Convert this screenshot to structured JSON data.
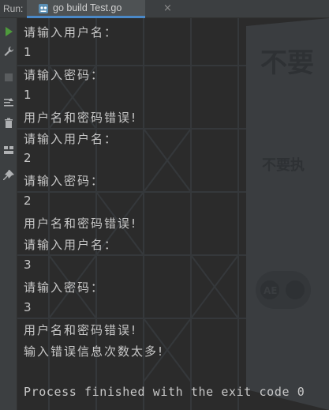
{
  "run_bar": {
    "label": "Run:",
    "tab_title": "go build Test.go"
  },
  "tool_icons": [
    "run-icon",
    "wrench-icon",
    "stop-icon",
    "sort-icon",
    "trash-icon",
    "layout-icon",
    "pin-icon"
  ],
  "console": {
    "lines": [
      "请输入用户名：",
      "1",
      "请输入密码：",
      "1",
      "用户名和密码错误!",
      "请输入用户名：",
      "2",
      "请输入密码：",
      "2",
      "用户名和密码错误!",
      "请输入用户名：",
      "3",
      "请输入密码：",
      "3",
      "用户名和密码错误!",
      "输入错误信息次数太多!"
    ],
    "exit_message": "Process finished with the exit code 0"
  },
  "background_image": {
    "sign_text_large": "不要",
    "sign_text_small": "不要执",
    "badge_text": "AE"
  },
  "colors": {
    "console_bg": "#2b2b2b",
    "console_text": "#c8c8c8",
    "toolbar_bg": "#3c3f41",
    "run_icon": "#4e9a3c",
    "tab_underline": "#4a88c7"
  }
}
